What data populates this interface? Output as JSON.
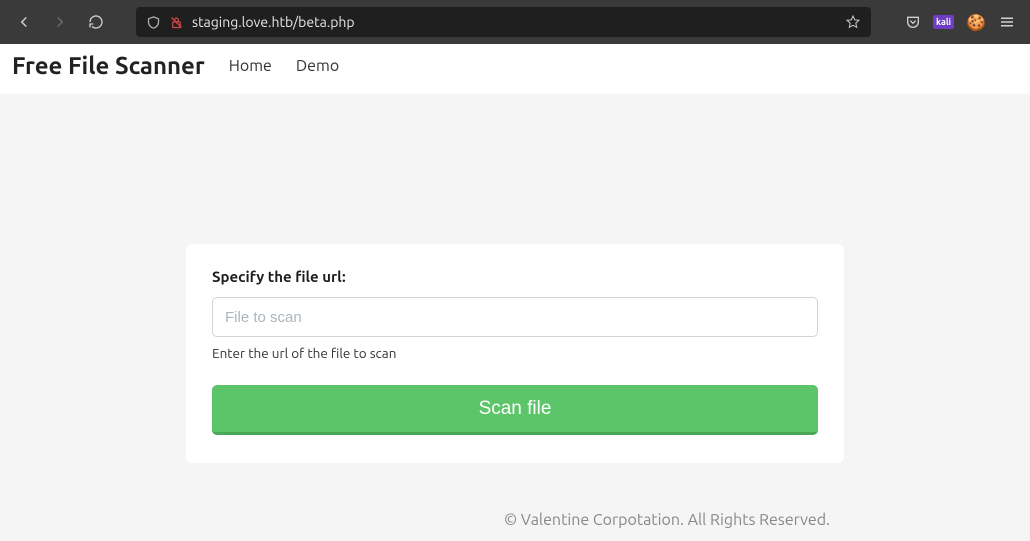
{
  "browser": {
    "url": "staging.love.htb/beta.php"
  },
  "icons": {
    "kali_label": "kali",
    "cookie": "🍪"
  },
  "navbar": {
    "brand": "Free File Scanner",
    "links": {
      "home": "Home",
      "demo": "Demo"
    }
  },
  "form": {
    "label": "Specify the file url:",
    "placeholder": "File to scan",
    "help": "Enter the url of the file to scan",
    "button": "Scan file"
  },
  "footer": {
    "text": "© Valentine Corpotation. All Rights Reserved."
  }
}
